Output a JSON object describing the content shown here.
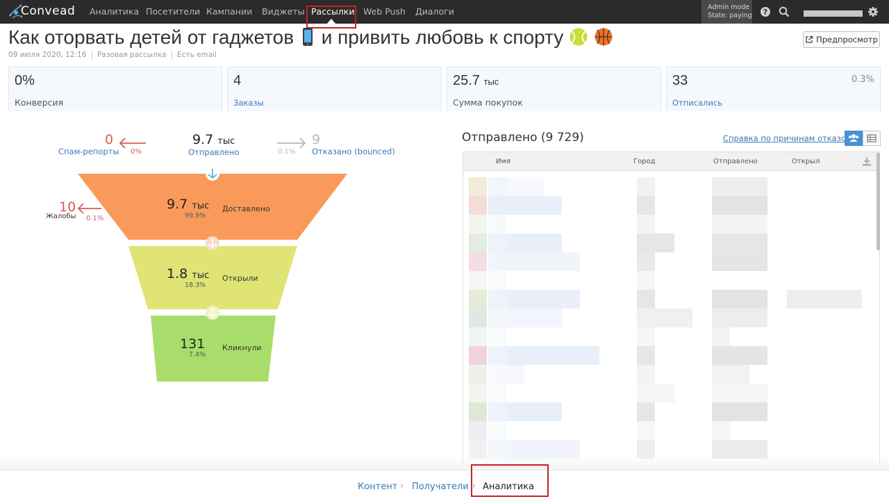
{
  "app": {
    "brand": "Convead"
  },
  "nav": {
    "items": [
      "Аналитика",
      "Посетители",
      "Кампании",
      "Виджеты",
      "Рассылки",
      "Web Push",
      "Диалоги"
    ],
    "active": "Рассылки"
  },
  "admin": {
    "line1": "Admin mode",
    "line2": "State: paying"
  },
  "page": {
    "title_part1": "Как оторвать детей от гаджетов",
    "title_part2": "и привить любовь к спорту",
    "date": "09 июля 2020, 12:16",
    "type": "Разовая рассылка",
    "audience": "Есть email",
    "preview_button": "Предпросмотр"
  },
  "stats": [
    {
      "value": "0%",
      "unit": "",
      "label": "Конверсия",
      "link": false,
      "pct": ""
    },
    {
      "value": "4",
      "unit": "",
      "label": "Заказы",
      "link": true,
      "pct": ""
    },
    {
      "value": "25.7",
      "unit": "тыс",
      "label": "Сумма покупок",
      "link": false,
      "pct": ""
    },
    {
      "value": "33",
      "unit": "",
      "label": "Отписались",
      "link": true,
      "pct": "0.3%"
    }
  ],
  "funnel": {
    "spam": {
      "value": "0",
      "label": "Спам-репорты",
      "pct": "0%"
    },
    "sent": {
      "value": "9.7",
      "unit": "тыс",
      "label": "Отправлено"
    },
    "bounced": {
      "value": "9",
      "label": "Отказано (bounced)",
      "pct": "0.1%"
    },
    "complaints": {
      "value": "10",
      "label": "Жалобы",
      "pct": "0.1%"
    },
    "delivered": {
      "value": "9.7",
      "unit": "тыс",
      "pct": "99.9%",
      "label": "Доставлено"
    },
    "opened": {
      "value": "1.8",
      "unit": "тыс",
      "pct": "18.3%",
      "label": "Открыли"
    },
    "clicked": {
      "value": "131",
      "unit": "",
      "pct": "7.4%",
      "label": "Кликнули"
    },
    "colors": {
      "delivered": "#f99a5b",
      "opened": "#dfe475",
      "clicked": "#a9dd6b"
    }
  },
  "table": {
    "title": "Отправлено (9 729)",
    "help_link": "Справка по причинам отказов",
    "columns": [
      "Имя",
      "Город",
      "Отправлено",
      "Открыл"
    ]
  },
  "breadcrumb": {
    "items": [
      "Контент",
      "Получатели",
      "Аналитика"
    ]
  }
}
